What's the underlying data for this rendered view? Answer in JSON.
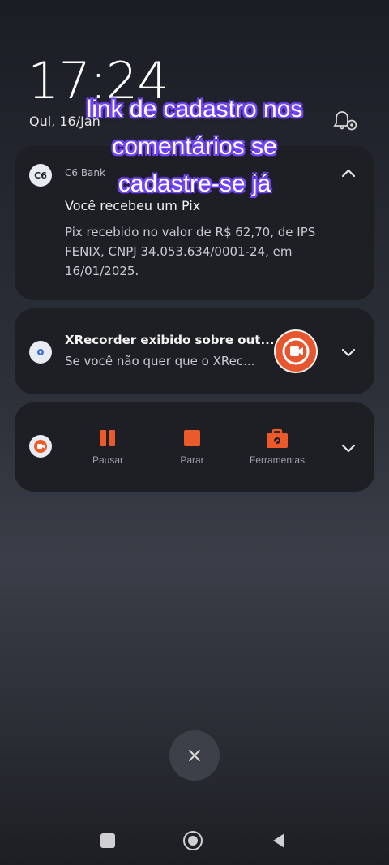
{
  "lockscreen": {
    "time": "17:24",
    "date": "Qui, 16/Jan"
  },
  "overlay_text": {
    "line1": "link de cadastro nos",
    "line2": "comentários se",
    "line3": "cadastre-se já"
  },
  "notifications": [
    {
      "app_name": "C6 Bank",
      "icon_text": "C6",
      "title": "Você recebeu um Pix",
      "body": "Pix recebido no valor de R$ 62,70, de IPS FENIX, CNPJ 34.053.634/0001-24, em 16/01/2025."
    },
    {
      "title": "XRecorder exibido sobre out...",
      "body": "Se você não quer que o XRec..."
    },
    {
      "controls": [
        {
          "label": "Pausar",
          "icon": "pause-icon"
        },
        {
          "label": "Parar",
          "icon": "stop-icon"
        },
        {
          "label": "Ferramentas",
          "icon": "toolbox-icon"
        }
      ]
    }
  ],
  "colors": {
    "accent": "#ec5a2a",
    "card_bg": "#1d1f24",
    "overlay_outline": "#7a4cff"
  }
}
